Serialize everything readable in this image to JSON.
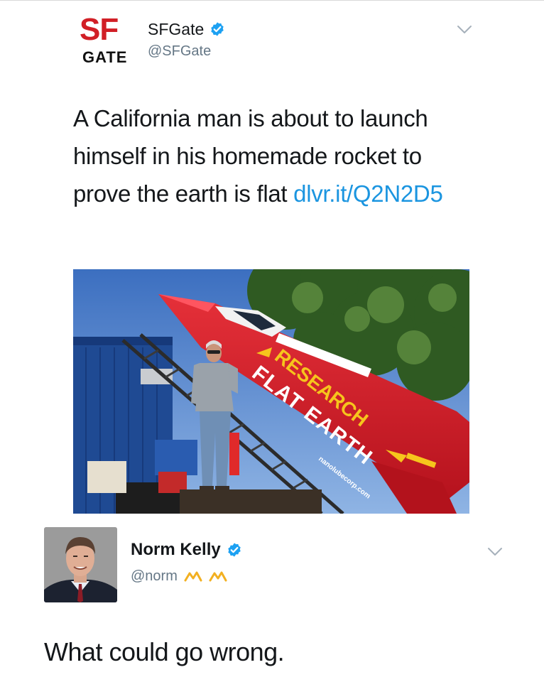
{
  "tweet1": {
    "logo": {
      "line1": "SF",
      "line2": "GATE",
      "color": "#d11f26"
    },
    "display_name": "SFGate",
    "handle": "@SFGate",
    "verified_icon": "verified-badge-icon",
    "menu_icon": "chevron-down-icon",
    "text": "A California man is about to launch himself in his homemade rocket to prove the earth is flat ",
    "link": "dlvr.it/Q2N2D5",
    "photo": {
      "rocket_lines": [
        "RESEARCH",
        "FLAT EARTH"
      ],
      "rocket_url": "nanolubecorp.com"
    }
  },
  "tweet2": {
    "display_name": "Norm Kelly",
    "handle": "@norm",
    "handle_emoji": "ᨓᨓ",
    "verified_icon": "verified-badge-icon",
    "menu_icon": "chevron-down-icon",
    "text": "What could go wrong."
  },
  "colors": {
    "verified_blue": "#1da1f2",
    "link_blue": "#1b95e0",
    "rocket_red": "#d41f2a",
    "rocket_yellow": "#f6c51c"
  }
}
